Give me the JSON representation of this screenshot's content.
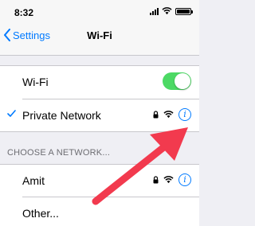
{
  "status_bar": {
    "time": "8:32"
  },
  "nav": {
    "back_label": "Settings",
    "title": "Wi-Fi"
  },
  "wifi_toggle": {
    "label": "Wi-Fi",
    "on": true
  },
  "connected_network": {
    "name": "Private Network"
  },
  "section_header": "CHOOSE A NETWORK...",
  "networks": [
    {
      "name": "Amit"
    },
    {
      "name": "Other..."
    }
  ],
  "colors": {
    "accent": "#007aff",
    "toggle_on": "#4cd964",
    "annotation_arrow": "#f23a4e"
  },
  "icons": [
    "back-chevron-icon",
    "checkmark-icon",
    "lock-icon",
    "wifi-icon",
    "info-icon",
    "cellular-signal-icon",
    "battery-icon"
  ]
}
